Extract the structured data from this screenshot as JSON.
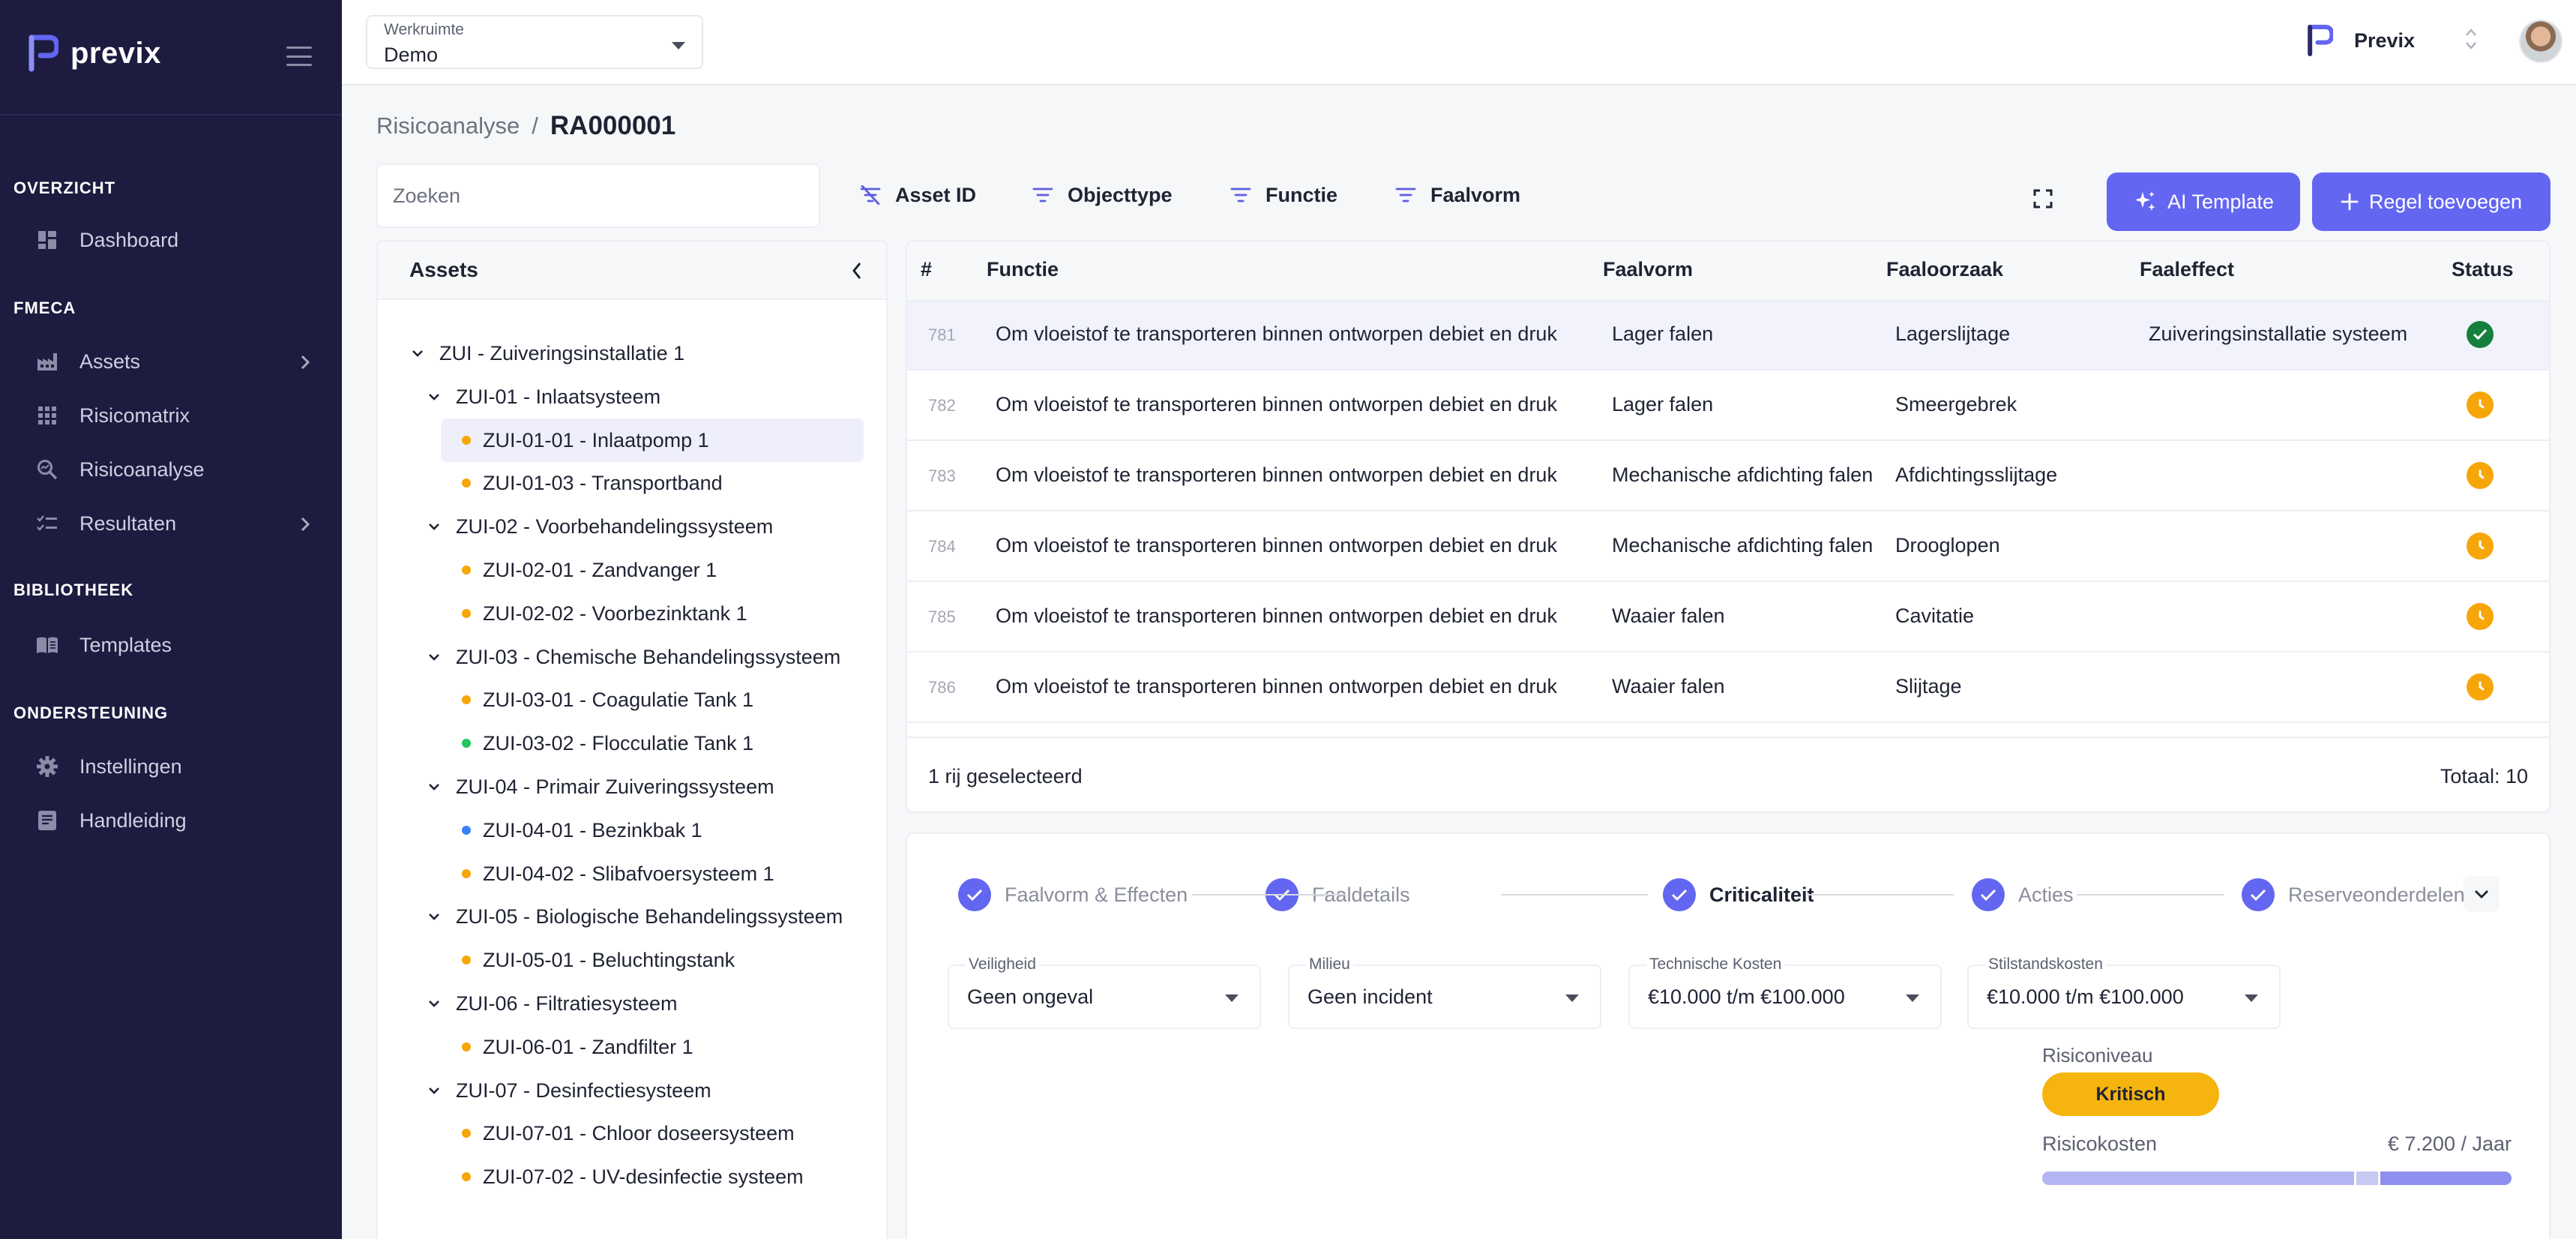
{
  "brand": {
    "name": "previx",
    "color": "#6366f1"
  },
  "sidebar": {
    "sections": [
      {
        "title": "OVERZICHT",
        "items": [
          {
            "label": "Dashboard",
            "icon": "dashboard-icon"
          }
        ]
      },
      {
        "title": "FMECA",
        "items": [
          {
            "label": "Assets",
            "icon": "factory-icon",
            "has_children": true
          },
          {
            "label": "Risicomatrix",
            "icon": "grid-icon"
          },
          {
            "label": "Risicoanalyse",
            "icon": "search-analytics-icon"
          },
          {
            "label": "Resultaten",
            "icon": "checklist-icon",
            "has_children": true
          }
        ]
      },
      {
        "title": "BIBLIOTHEEK",
        "items": [
          {
            "label": "Templates",
            "icon": "book-icon"
          }
        ]
      },
      {
        "title": "ONDERSTEUNING",
        "items": [
          {
            "label": "Instellingen",
            "icon": "gear-icon"
          },
          {
            "label": "Handleiding",
            "icon": "document-icon"
          }
        ]
      }
    ]
  },
  "topbar": {
    "workspace_label": "Werkruimte",
    "workspace_value": "Demo",
    "org_name": "Previx"
  },
  "breadcrumb": {
    "parent": "Risicoanalyse",
    "separator": "/",
    "current": "RA000001"
  },
  "search": {
    "placeholder": "Zoeken"
  },
  "filters": [
    "Asset ID",
    "Objecttype",
    "Functie",
    "Faalvorm"
  ],
  "buttons": {
    "ai_template": "AI Template",
    "add_rule": "Regel toevoegen"
  },
  "assets_panel": {
    "title": "Assets",
    "tree": [
      {
        "label": "ZUI - Zuiveringsinstallatie 1",
        "level": 0,
        "expanded": true
      },
      {
        "label": "ZUI-01 - Inlaatsysteem",
        "level": 1,
        "expanded": true
      },
      {
        "label": "ZUI-01-01 - Inlaatpomp 1",
        "level": 2,
        "status": "#f6a609",
        "selected": true
      },
      {
        "label": "ZUI-01-03 - Transportband",
        "level": 2,
        "status": "#f6a609"
      },
      {
        "label": "ZUI-02 - Voorbehandelingssysteem",
        "level": 1,
        "expanded": true
      },
      {
        "label": "ZUI-02-01 - Zandvanger 1",
        "level": 2,
        "status": "#f6a609"
      },
      {
        "label": "ZUI-02-02 - Voorbezinktank 1",
        "level": 2,
        "status": "#f6a609"
      },
      {
        "label": "ZUI-03 - Chemische Behandelingssysteem",
        "level": 1,
        "expanded": true
      },
      {
        "label": "ZUI-03-01 - Coagulatie Tank 1",
        "level": 2,
        "status": "#f6a609"
      },
      {
        "label": "ZUI-03-02 - Flocculatie Tank 1",
        "level": 2,
        "status": "#22c55e"
      },
      {
        "label": "ZUI-04 - Primair Zuiveringssysteem",
        "level": 1,
        "expanded": true
      },
      {
        "label": "ZUI-04-01 - Bezinkbak 1",
        "level": 2,
        "status": "#3b82f6"
      },
      {
        "label": "ZUI-04-02 - Slibafvoersysteem 1",
        "level": 2,
        "status": "#f6a609"
      },
      {
        "label": "ZUI-05 - Biologische Behandelingssysteem",
        "level": 1,
        "expanded": true
      },
      {
        "label": "ZUI-05-01 - Beluchtingstank",
        "level": 2,
        "status": "#f6a609"
      },
      {
        "label": "ZUI-06 - Filtratiesysteem",
        "level": 1,
        "expanded": true
      },
      {
        "label": "ZUI-06-01 - Zandfilter 1",
        "level": 2,
        "status": "#f6a609"
      },
      {
        "label": "ZUI-07 - Desinfectiesysteem",
        "level": 1,
        "expanded": true
      },
      {
        "label": "ZUI-07-01 - Chloor doseersysteem",
        "level": 2,
        "status": "#f6a609"
      },
      {
        "label": "ZUI-07-02 - UV-desinfectie systeem",
        "level": 2,
        "status": "#f6a609"
      }
    ]
  },
  "table": {
    "columns": [
      "#",
      "Functie",
      "Faalvorm",
      "Faaloorzaak",
      "Faaleffect",
      "Status"
    ],
    "rows": [
      {
        "id": "781",
        "functie": "Om vloeistof te transporteren binnen ontworpen debiet en druk",
        "faalvorm": "Lager falen",
        "faaloorzaak": "Lagerslijtage",
        "faaleffect": "Zuiveringsinstallatie systeem",
        "status": "done",
        "selected": true
      },
      {
        "id": "782",
        "functie": "Om vloeistof te transporteren binnen ontworpen debiet en druk",
        "faalvorm": "Lager falen",
        "faaloorzaak": "Smeergebrek",
        "faaleffect": "",
        "status": "pending"
      },
      {
        "id": "783",
        "functie": "Om vloeistof te transporteren binnen ontworpen debiet en druk",
        "faalvorm": "Mechanische afdichting falen",
        "faaloorzaak": "Afdichtingsslijtage",
        "faaleffect": "",
        "status": "pending"
      },
      {
        "id": "784",
        "functie": "Om vloeistof te transporteren binnen ontworpen debiet en druk",
        "faalvorm": "Mechanische afdichting falen",
        "faaloorzaak": "Drooglopen",
        "faaleffect": "",
        "status": "pending"
      },
      {
        "id": "785",
        "functie": "Om vloeistof te transporteren binnen ontworpen debiet en druk",
        "faalvorm": "Waaier falen",
        "faaloorzaak": "Cavitatie",
        "faaleffect": "",
        "status": "pending"
      },
      {
        "id": "786",
        "functie": "Om vloeistof te transporteren binnen ontworpen debiet en druk",
        "faalvorm": "Waaier falen",
        "faaloorzaak": "Slijtage",
        "faaleffect": "",
        "status": "pending"
      }
    ],
    "selected_text": "1 rij geselecteerd",
    "total_text": "Totaal: 10",
    "status_colors": {
      "done": "#15803d",
      "pending": "#f6a609"
    }
  },
  "detail": {
    "steps": [
      {
        "label": "Faalvorm & Effecten",
        "active": false
      },
      {
        "label": "Faaldetails",
        "active": false
      },
      {
        "label": "Criticaliteit",
        "active": true
      },
      {
        "label": "Acties",
        "active": false
      },
      {
        "label": "Reserveonderdelen",
        "active": false
      }
    ],
    "fields": [
      {
        "label": "Veiligheid",
        "value": "Geen ongeval"
      },
      {
        "label": "Milieu",
        "value": "Geen incident"
      },
      {
        "label": "Technische Kosten",
        "value": "€10.000 t/m €100.000"
      },
      {
        "label": "Stilstandskosten",
        "value": "€10.000 t/m €100.000"
      }
    ],
    "risk_level_label": "Risiconiveau",
    "risk_level_value": "Kritisch",
    "risk_level_color": "#f6b40e",
    "risk_cost_label": "Risicokosten",
    "risk_cost_value": "€ 7.200 / Jaar",
    "risk_cost_split": [
      0.665,
      0.055,
      0.28
    ]
  }
}
